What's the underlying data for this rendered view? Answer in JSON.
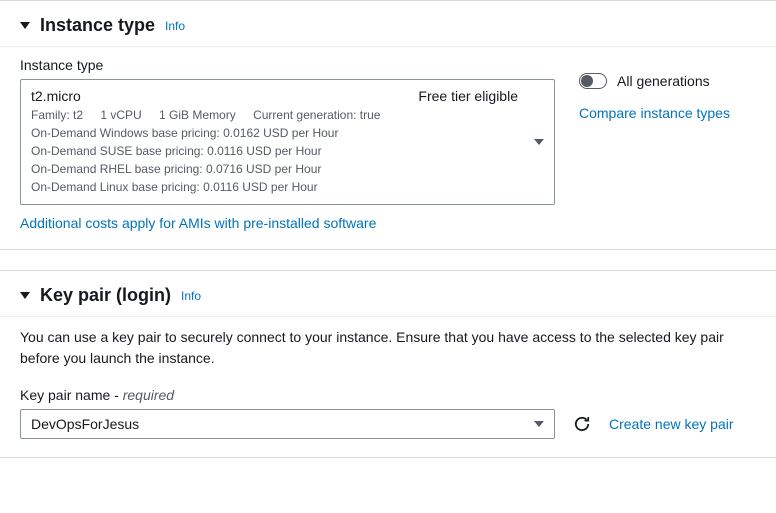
{
  "instance_type_section": {
    "title": "Instance type",
    "info": "Info",
    "field_label": "Instance type",
    "selected": {
      "name": "t2.micro",
      "badge": "Free tier eligible",
      "family": "Family: t2",
      "vcpu": "1 vCPU",
      "memory": "1 GiB Memory",
      "current_gen": "Current generation: true",
      "pricing_windows": "On-Demand Windows base pricing: 0.0162 USD per Hour",
      "pricing_suse": "On-Demand SUSE base pricing: 0.0116 USD per Hour",
      "pricing_rhel": "On-Demand RHEL base pricing: 0.0716 USD per Hour",
      "pricing_linux": "On-Demand Linux base pricing: 0.0116 USD per Hour"
    },
    "additional_costs_link": "Additional costs apply for AMIs with pre-installed software",
    "all_generations": "All generations",
    "compare_link": "Compare instance types"
  },
  "keypair_section": {
    "title": "Key pair (login)",
    "info": "Info",
    "description": "You can use a key pair to securely connect to your instance. Ensure that you have access to the selected key pair before you launch the instance.",
    "field_label": "Key pair name - ",
    "field_required": "required",
    "selected": "DevOpsForJesus",
    "create_link": "Create new key pair"
  }
}
